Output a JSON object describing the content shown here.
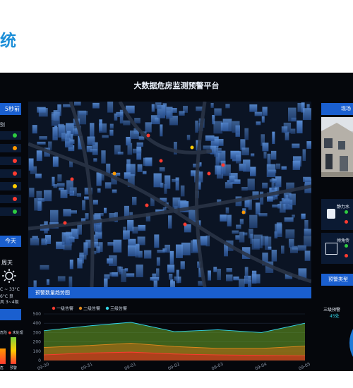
{
  "heading": "统",
  "platform_title": "大数据危房监测预警平台",
  "left": {
    "header": "5秒前",
    "subheader": "别",
    "status_dots": [
      "#2ecc40",
      "#ff9900",
      "#ff3b30",
      "#ff3b30",
      "#ffcc00",
      "#ff3b30",
      "#2ecc40"
    ],
    "today_tab": "今天",
    "weather_day": "周天",
    "weather_temp": "C ~ 33°C",
    "weather_desc": "6°C 良",
    "weather_wind": "风 3~4级",
    "legend_a": "危险",
    "legend_b": "未处理",
    "x_a": "危",
    "x_b": "预警"
  },
  "chart_data": {
    "type": "area",
    "title": "预警数量趋势图",
    "x": [
      "09-30",
      "09-31",
      "09-01",
      "09-02",
      "09-03",
      "09-04",
      "09-05"
    ],
    "ylim": [
      0,
      500
    ],
    "yticks": [
      0,
      100,
      200,
      300,
      400,
      500
    ],
    "grid": true,
    "legend_position": "top-left",
    "series": [
      {
        "name": "一级告警",
        "color": "#ff3b30",
        "values": [
          60,
          80,
          90,
          70,
          60,
          55,
          50
        ]
      },
      {
        "name": "二级告警",
        "color": "#e08a1e",
        "values": [
          140,
          160,
          185,
          150,
          130,
          130,
          155
        ]
      },
      {
        "name": "三级告警",
        "color": "#33d6e8",
        "values": [
          320,
          370,
          410,
          310,
          330,
          300,
          400
        ]
      }
    ]
  },
  "right": {
    "header": "现场",
    "sensor1_label": "静力水",
    "sensor2_label": "倾角传",
    "alert_type_header": "预警类型",
    "level3_label": "三级预警",
    "level3_count": "45处"
  },
  "colors": {
    "accent": "#1a5fcf",
    "screen_bg": "#05070c",
    "heading": "#1e8fd8"
  }
}
